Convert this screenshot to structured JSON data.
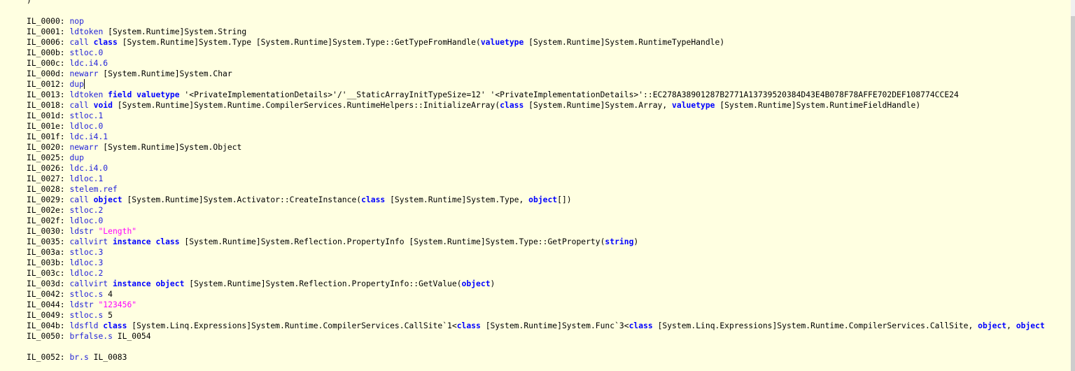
{
  "colors": {
    "background": "#ffffe1",
    "opcode": "#2323d8",
    "keyword": "#0000ff",
    "string": "#ff00ff",
    "text": "#000000"
  },
  "cursor_line": 9,
  "lines": [
    [
      [
        "txt",
        ")"
      ]
    ],
    [],
    [
      [
        "txt",
        "IL_0000: "
      ],
      [
        "op",
        "nop"
      ]
    ],
    [
      [
        "txt",
        "IL_0001: "
      ],
      [
        "op",
        "ldtoken"
      ],
      [
        "txt",
        " [System.Runtime]System.String"
      ]
    ],
    [
      [
        "txt",
        "IL_0006: "
      ],
      [
        "op",
        "call"
      ],
      [
        "txt",
        " "
      ],
      [
        "kw",
        "class"
      ],
      [
        "txt",
        " [System.Runtime]System.Type [System.Runtime]System.Type::GetTypeFromHandle("
      ],
      [
        "kw",
        "valuetype"
      ],
      [
        "txt",
        " [System.Runtime]System.RuntimeTypeHandle)"
      ]
    ],
    [
      [
        "txt",
        "IL_000b: "
      ],
      [
        "op",
        "stloc.0"
      ]
    ],
    [
      [
        "txt",
        "IL_000c: "
      ],
      [
        "op",
        "ldc.i4.6"
      ]
    ],
    [
      [
        "txt",
        "IL_000d: "
      ],
      [
        "op",
        "newarr"
      ],
      [
        "txt",
        " [System.Runtime]System.Char"
      ]
    ],
    [
      [
        "txt",
        "IL_0012: "
      ],
      [
        "op",
        "dup"
      ]
    ],
    [
      [
        "txt",
        "IL_0013: "
      ],
      [
        "op",
        "ldtoken"
      ],
      [
        "txt",
        " "
      ],
      [
        "kw",
        "field"
      ],
      [
        "txt",
        " "
      ],
      [
        "kw",
        "valuetype"
      ],
      [
        "txt",
        " '<PrivateImplementationDetails>'/'__StaticArrayInitTypeSize=12' '<PrivateImplementationDetails>'::EC278A38901287B2771A13739520384D43E4B078F78AFFE702DEF108774CCE24"
      ]
    ],
    [
      [
        "txt",
        "IL_0018: "
      ],
      [
        "op",
        "call"
      ],
      [
        "txt",
        " "
      ],
      [
        "kw",
        "void"
      ],
      [
        "txt",
        " [System.Runtime]System.Runtime.CompilerServices.RuntimeHelpers::InitializeArray("
      ],
      [
        "kw",
        "class"
      ],
      [
        "txt",
        " [System.Runtime]System.Array, "
      ],
      [
        "kw",
        "valuetype"
      ],
      [
        "txt",
        " [System.Runtime]System.RuntimeFieldHandle)"
      ]
    ],
    [
      [
        "txt",
        "IL_001d: "
      ],
      [
        "op",
        "stloc.1"
      ]
    ],
    [
      [
        "txt",
        "IL_001e: "
      ],
      [
        "op",
        "ldloc.0"
      ]
    ],
    [
      [
        "txt",
        "IL_001f: "
      ],
      [
        "op",
        "ldc.i4.1"
      ]
    ],
    [
      [
        "txt",
        "IL_0020: "
      ],
      [
        "op",
        "newarr"
      ],
      [
        "txt",
        " [System.Runtime]System.Object"
      ]
    ],
    [
      [
        "txt",
        "IL_0025: "
      ],
      [
        "op",
        "dup"
      ]
    ],
    [
      [
        "txt",
        "IL_0026: "
      ],
      [
        "op",
        "ldc.i4.0"
      ]
    ],
    [
      [
        "txt",
        "IL_0027: "
      ],
      [
        "op",
        "ldloc.1"
      ]
    ],
    [
      [
        "txt",
        "IL_0028: "
      ],
      [
        "op",
        "stelem.ref"
      ]
    ],
    [
      [
        "txt",
        "IL_0029: "
      ],
      [
        "op",
        "call"
      ],
      [
        "txt",
        " "
      ],
      [
        "kw",
        "object"
      ],
      [
        "txt",
        " [System.Runtime]System.Activator::CreateInstance("
      ],
      [
        "kw",
        "class"
      ],
      [
        "txt",
        " [System.Runtime]System.Type, "
      ],
      [
        "kw",
        "object"
      ],
      [
        "txt",
        "[])"
      ]
    ],
    [
      [
        "txt",
        "IL_002e: "
      ],
      [
        "op",
        "stloc.2"
      ]
    ],
    [
      [
        "txt",
        "IL_002f: "
      ],
      [
        "op",
        "ldloc.0"
      ]
    ],
    [
      [
        "txt",
        "IL_0030: "
      ],
      [
        "op",
        "ldstr"
      ],
      [
        "txt",
        " "
      ],
      [
        "str",
        "\"Length\""
      ]
    ],
    [
      [
        "txt",
        "IL_0035: "
      ],
      [
        "op",
        "callvirt"
      ],
      [
        "txt",
        " "
      ],
      [
        "kw",
        "instance"
      ],
      [
        "txt",
        " "
      ],
      [
        "kw",
        "class"
      ],
      [
        "txt",
        " [System.Runtime]System.Reflection.PropertyInfo [System.Runtime]System.Type::GetProperty("
      ],
      [
        "kw",
        "string"
      ],
      [
        "txt",
        ")"
      ]
    ],
    [
      [
        "txt",
        "IL_003a: "
      ],
      [
        "op",
        "stloc.3"
      ]
    ],
    [
      [
        "txt",
        "IL_003b: "
      ],
      [
        "op",
        "ldloc.3"
      ]
    ],
    [
      [
        "txt",
        "IL_003c: "
      ],
      [
        "op",
        "ldloc.2"
      ]
    ],
    [
      [
        "txt",
        "IL_003d: "
      ],
      [
        "op",
        "callvirt"
      ],
      [
        "txt",
        " "
      ],
      [
        "kw",
        "instance"
      ],
      [
        "txt",
        " "
      ],
      [
        "kw",
        "object"
      ],
      [
        "txt",
        " [System.Runtime]System.Reflection.PropertyInfo::GetValue("
      ],
      [
        "kw",
        "object"
      ],
      [
        "txt",
        ")"
      ]
    ],
    [
      [
        "txt",
        "IL_0042: "
      ],
      [
        "op",
        "stloc.s"
      ],
      [
        "txt",
        " 4"
      ]
    ],
    [
      [
        "txt",
        "IL_0044: "
      ],
      [
        "op",
        "ldstr"
      ],
      [
        "txt",
        " "
      ],
      [
        "str",
        "\"123456\""
      ]
    ],
    [
      [
        "txt",
        "IL_0049: "
      ],
      [
        "op",
        "stloc.s"
      ],
      [
        "txt",
        " 5"
      ]
    ],
    [
      [
        "txt",
        "IL_004b: "
      ],
      [
        "op",
        "ldsfld"
      ],
      [
        "txt",
        " "
      ],
      [
        "kw",
        "class"
      ],
      [
        "txt",
        " [System.Linq.Expressions]System.Runtime.CompilerServices.CallSite`1<"
      ],
      [
        "kw",
        "class"
      ],
      [
        "txt",
        " [System.Runtime]System.Func`3<"
      ],
      [
        "kw",
        "class"
      ],
      [
        "txt",
        " [System.Linq.Expressions]System.Runtime.CompilerServices.CallSite, "
      ],
      [
        "kw",
        "object"
      ],
      [
        "txt",
        ", "
      ],
      [
        "kw",
        "object"
      ]
    ],
    [
      [
        "txt",
        "IL_0050: "
      ],
      [
        "op",
        "brfalse.s"
      ],
      [
        "txt",
        " IL_0054"
      ]
    ],
    [],
    [
      [
        "txt",
        "IL_0052: "
      ],
      [
        "op",
        "br.s"
      ],
      [
        "txt",
        " IL_0083"
      ]
    ]
  ]
}
